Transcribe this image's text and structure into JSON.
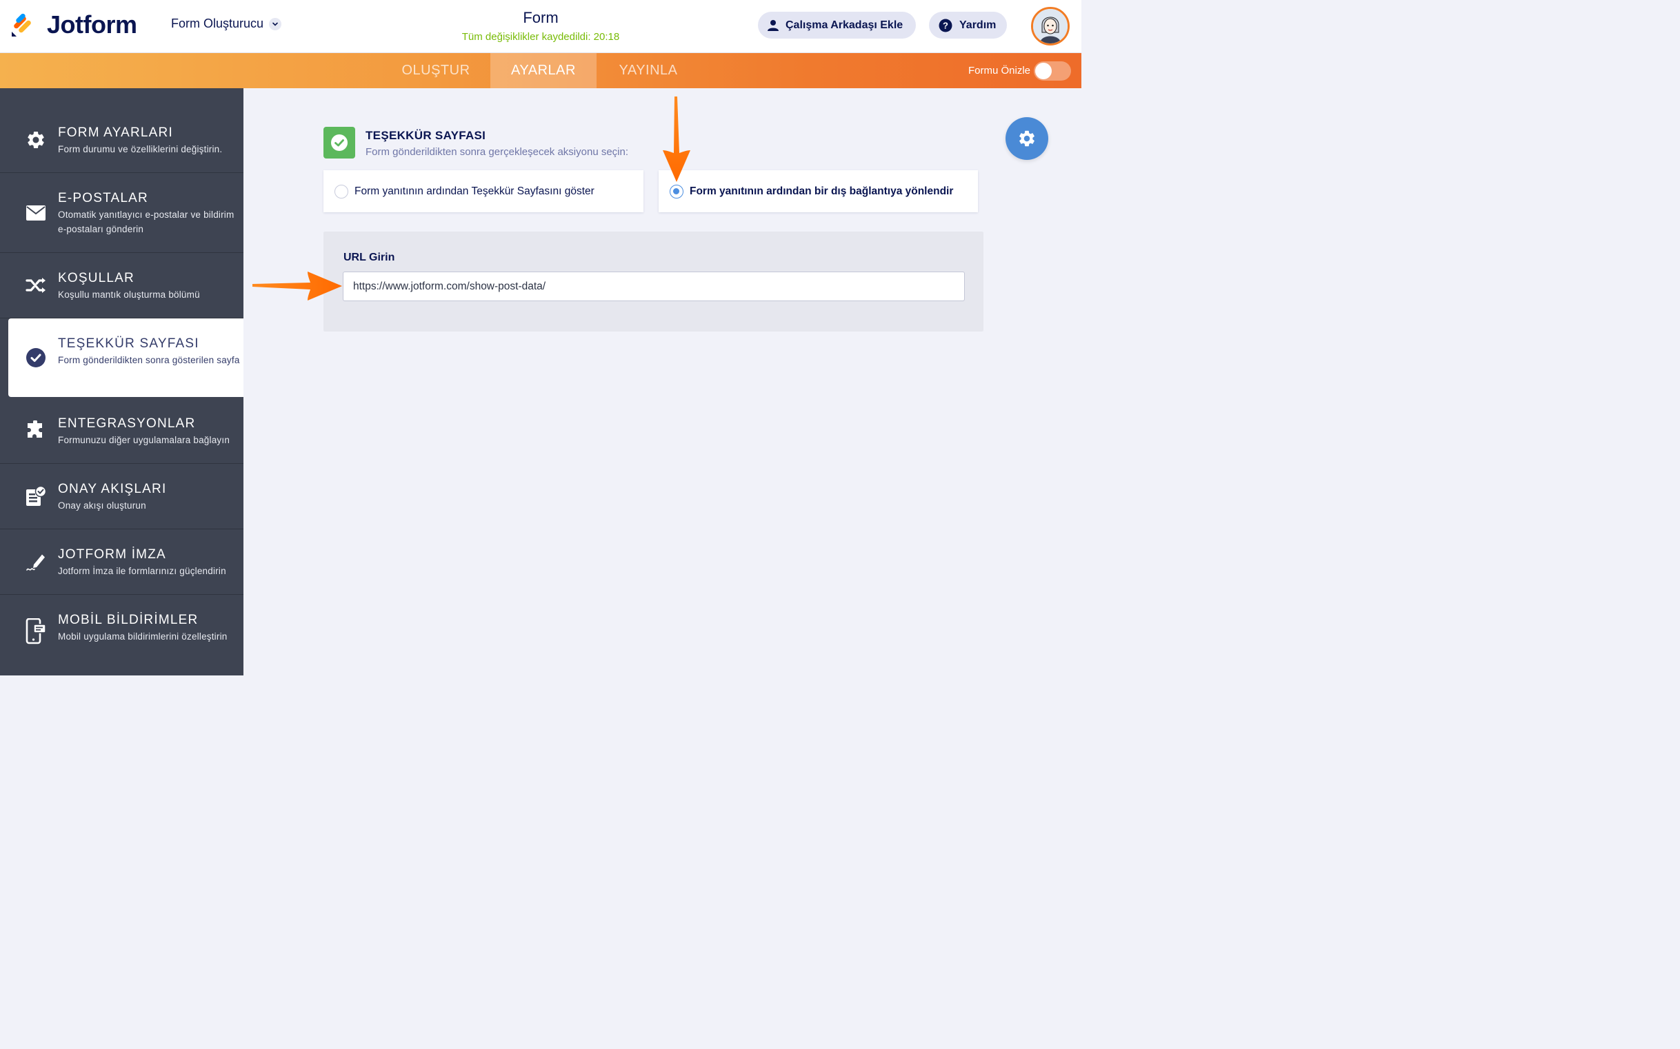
{
  "app": {
    "logo_text": "Jotform",
    "builder_label": "Form Oluşturucu",
    "form_title": "Form",
    "save_status": "Tüm değişiklikler kaydedildi: 20:18",
    "invite_label": "Çalışma Arkadaşı Ekle",
    "help_label": "Yardım"
  },
  "nav": {
    "tabs": [
      {
        "label": "OLUŞTUR"
      },
      {
        "label": "AYARLAR"
      },
      {
        "label": "YAYINLA"
      }
    ],
    "preview_label": "Formu Önizle"
  },
  "sidebar": {
    "items": [
      {
        "title": "FORM AYARLARI",
        "desc": "Form durumu ve özelliklerini değiştirin."
      },
      {
        "title": "E-POSTALAR",
        "desc": "Otomatik yanıtlayıcı e-postalar ve bildirim e-postaları gönderin"
      },
      {
        "title": "KOŞULLAR",
        "desc": "Koşullu mantık oluşturma bölümü"
      },
      {
        "title": "TEŞEKKÜR SAYFASI",
        "desc": "Form gönderildikten sonra gösterilen sayfa"
      },
      {
        "title": "ENTEGRASYONLAR",
        "desc": "Formunuzu diğer uygulamalara bağlayın"
      },
      {
        "title": "ONAY AKIŞLARI",
        "desc": "Onay akışı oluşturun"
      },
      {
        "title": "JOTFORM İMZA",
        "desc": "Jotform İmza ile formlarınızı güçlendirin"
      },
      {
        "title": "MOBİL BİLDİRİMLER",
        "desc": "Mobil uygulama bildirimlerini özelleştirin"
      }
    ]
  },
  "main": {
    "section_title": "TEŞEKKÜR SAYFASI",
    "section_subtitle": "Form gönderildikten sonra gerçekleşecek aksiyonu seçin:",
    "options": [
      {
        "label": "Form yanıtının ardından Teşekkür Sayfasını göster",
        "selected": false
      },
      {
        "label": "Form yanıtının ardından bir dış bağlantıya yönlendir",
        "selected": true
      }
    ],
    "url_label": "URL Girin",
    "url_value": "https://www.jotform.com/show-post-data/"
  },
  "colors": {
    "accent_orange": "#f07a2e",
    "sidebar_bg": "#3e4452",
    "success_green": "#5cb85c",
    "fab_blue": "#4a8ad6",
    "saved_green": "#78bb07"
  }
}
